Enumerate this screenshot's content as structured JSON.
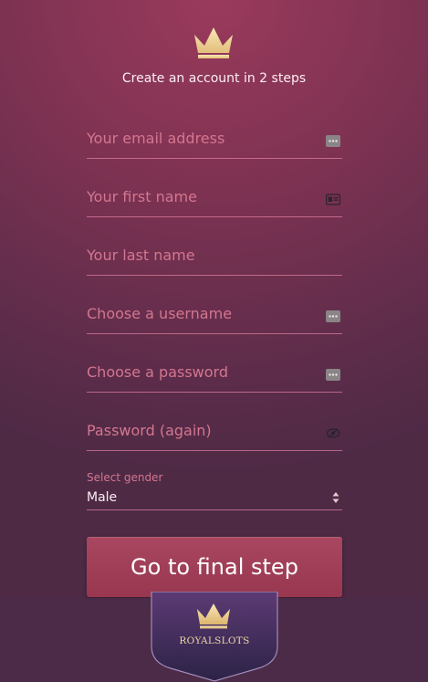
{
  "header": {
    "logo_icon": "crown-icon",
    "title": "Create an account in 2 steps"
  },
  "form": {
    "fields": [
      {
        "placeholder": "Your email address",
        "icon": "dots-icon"
      },
      {
        "placeholder": "Your first name",
        "icon": "id-card-icon"
      },
      {
        "placeholder": "Your last name",
        "icon": ""
      },
      {
        "placeholder": "Choose a username",
        "icon": "dots-icon"
      },
      {
        "placeholder": "Choose a password",
        "icon": "dots-icon"
      },
      {
        "placeholder": "Password (again)",
        "icon": "eye-icon"
      }
    ],
    "gender": {
      "label": "Select gender",
      "value": "Male"
    },
    "submit_label": "Go to final step"
  },
  "footer": {
    "brand": "ROYALSLOTS",
    "icon": "crown-icon"
  },
  "colors": {
    "accent": "#a94661",
    "placeholder": "#d4768f",
    "brand_gold": "#f1d7a4"
  }
}
